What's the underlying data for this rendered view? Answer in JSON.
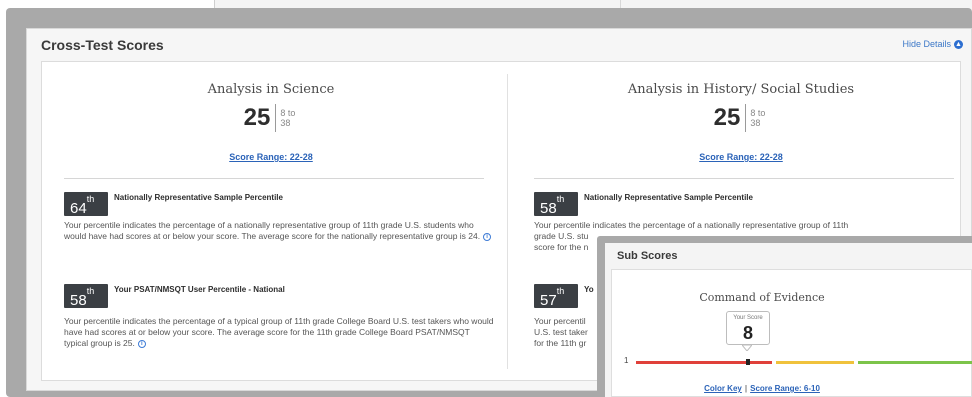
{
  "card": {
    "title": "Cross-Test Scores",
    "hide_details": "Hide Details"
  },
  "tests": [
    {
      "title": "Analysis in Science",
      "score": "25",
      "range_low": "8 to",
      "range_high": "38",
      "score_range_link": "Score Range: 22-28",
      "percentiles": [
        {
          "value": "64",
          "suffix": "th",
          "label": "Nationally Representative Sample Percentile",
          "description": "Your percentile indicates the percentage of a nationally representative group of 11th grade U.S. students who would have had scores at or below your score. The average score for the nationally representative group is 24."
        },
        {
          "value": "58",
          "suffix": "th",
          "label": "Your PSAT/NMSQT User Percentile - National",
          "description": "Your percentile indicates the percentage of a typical group of 11th grade College Board U.S. test takers who would have had scores at or below your score. The average score for the 11th grade College Board PSAT/NMSQT typical group is 25."
        }
      ]
    },
    {
      "title": "Analysis in History/ Social Studies",
      "score": "25",
      "range_low": "8 to",
      "range_high": "38",
      "score_range_link": "Score Range: 22-28",
      "percentiles": [
        {
          "value": "58",
          "suffix": "th",
          "label": "Nationally Representative Sample Percentile",
          "description_visible_line1": "Your percentile indicates the percentage of a nationally representative group of 11th",
          "description_visible_line2": "grade U.S. stu",
          "description_visible_line3": "score for the n"
        },
        {
          "value": "57",
          "suffix": "th",
          "label": "Yo",
          "description_visible_line1": "Your percentil",
          "description_visible_line2": "U.S. test taker",
          "description_visible_line3": "for the 11th gr"
        }
      ]
    }
  ],
  "sub_scores": {
    "panel_title": "Sub Scores",
    "test_title": "Command of Evidence",
    "your_score_label": "Your Score",
    "your_score": "8",
    "scale_min": "1",
    "color_key": "Color Key",
    "pipe": "|",
    "score_range_link": "Score Range: 6-10",
    "colors": {
      "low": "#e0403a",
      "mid": "#f0c23c",
      "high": "#7cc44a"
    }
  }
}
